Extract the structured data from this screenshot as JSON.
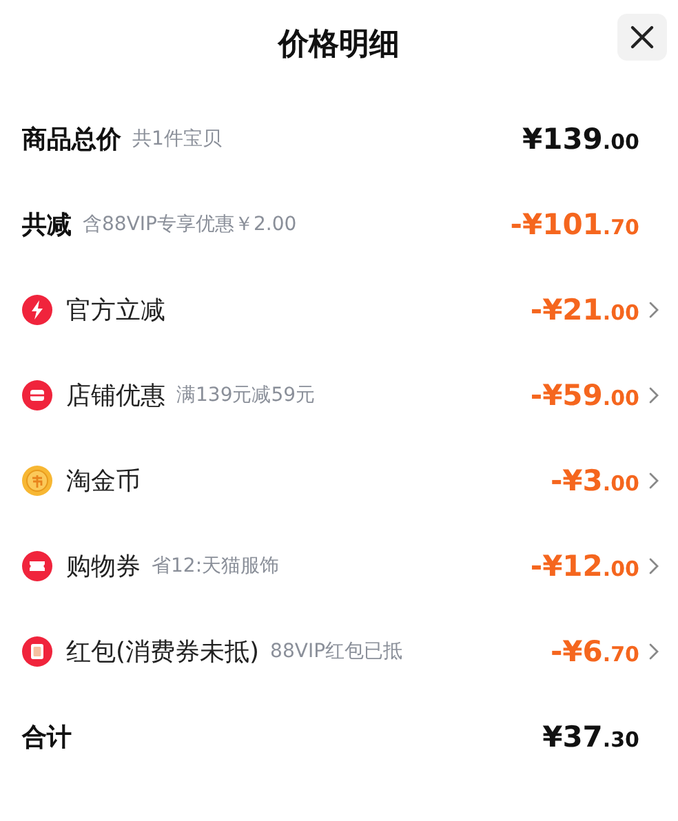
{
  "title": "价格明细",
  "rows": [
    {
      "kind": "total",
      "label": "商品总价",
      "note": "共1件宝贝",
      "amount": "¥139",
      "cents": ".00"
    },
    {
      "kind": "saving",
      "label": "共减",
      "note": "含88VIP专享优惠￥2.00",
      "amount": "-¥101",
      "cents": ".70"
    },
    {
      "kind": "instant",
      "label": "官方立减",
      "amount": "-¥21",
      "cents": ".00"
    },
    {
      "kind": "shop",
      "label": "店铺优惠",
      "note": "满139元减59元",
      "amount": "-¥59",
      "cents": ".00"
    },
    {
      "kind": "coins",
      "label": "淘金币",
      "amount": "-¥3",
      "cents": ".00"
    },
    {
      "kind": "coupon",
      "label": "购物券",
      "note": "省12:天猫服饰",
      "amount": "-¥12",
      "cents": ".00"
    },
    {
      "kind": "envelope",
      "label": "红包(消费券未抵)",
      "note": "88VIP红包已抵",
      "amount": "-¥6",
      "cents": ".70"
    },
    {
      "kind": "total",
      "label": "合计",
      "amount": "¥37",
      "cents": ".30"
    }
  ]
}
